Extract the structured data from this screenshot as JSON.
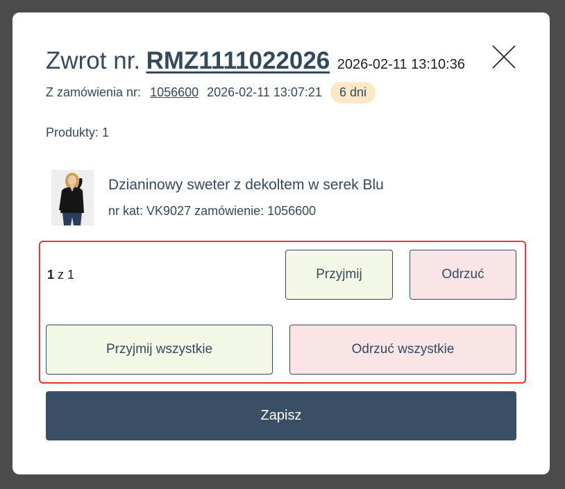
{
  "header": {
    "title_prefix": "Zwrot nr.",
    "return_number": "RMZ1111022026",
    "return_datetime": "2026-02-11 13:10:36",
    "close_icon": "close-icon"
  },
  "order": {
    "label": "Z zamówienia nr:",
    "number": "1056600",
    "datetime": "2026-02-11 13:07:21",
    "days_badge": "6 dni"
  },
  "products": {
    "count_label": "Produkty: 1",
    "items": [
      {
        "name": "Dzianinowy sweter z dekoltem w serek Blu",
        "meta": "nr kat: VK9027 zamówienie: 1056600"
      }
    ]
  },
  "decision": {
    "pager_current": "1",
    "pager_rest": " z 1",
    "accept_label": "Przyjmij",
    "reject_label": "Odrzuć",
    "accept_all_label": "Przyjmij wszystkie",
    "reject_all_label": "Odrzuć wszystkie"
  },
  "footer": {
    "save_label": "Zapisz"
  },
  "colors": {
    "overlay": "#4a4b4a",
    "primary": "#3a4e66",
    "text": "#34495e",
    "accept_bg": "#f3f7e6",
    "reject_bg": "#f9e4e6",
    "badge_bg": "#fbe8c7",
    "highlight_border": "#e53935"
  }
}
